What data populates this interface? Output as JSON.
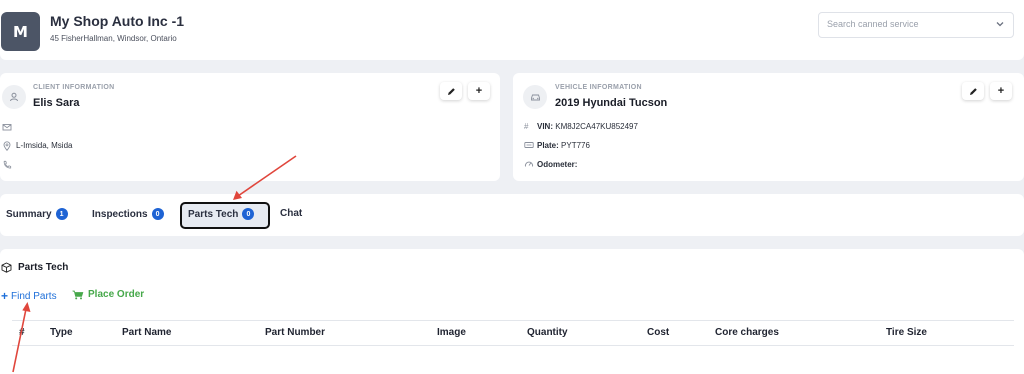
{
  "header": {
    "avatar_letter": "M",
    "shop_name": "My Shop Auto Inc -1",
    "shop_address": "45 FisherHallman, Windsor, Ontario",
    "search_placeholder": "Search canned service"
  },
  "client": {
    "kicker": "CLIENT INFORMATION",
    "name": "Elis Sara",
    "address": "L-Imsida, Msida",
    "email": "",
    "phone": ""
  },
  "vehicle": {
    "kicker": "VEHICLE INFORMATION",
    "name": "2019 Hyundai Tucson",
    "vin_label": "VIN:",
    "vin_value": "KM8J2CA47KU852497",
    "plate_label": "Plate:",
    "plate_value": "PYT776",
    "odometer_label": "Odometer:",
    "odometer_value": ""
  },
  "tabs": [
    {
      "label": "Summary",
      "badge": "1"
    },
    {
      "label": "Inspections",
      "badge": "0"
    },
    {
      "label": "Parts Tech",
      "badge": "0",
      "active": true
    },
    {
      "label": "Chat"
    }
  ],
  "parts_tech": {
    "title": "Parts Tech",
    "find_parts": "Find Parts",
    "place_order": "Place Order",
    "columns": [
      "#",
      "Type",
      "Part Name",
      "Part Number",
      "Image",
      "Quantity",
      "Cost",
      "Core charges",
      "Tire Size"
    ]
  },
  "colors": {
    "accent_blue": "#1e63d4",
    "link_blue": "#1e6fd9",
    "order_green": "#46a84a",
    "annotation_red": "#e0463c",
    "avatar_bg": "#4c5566"
  }
}
